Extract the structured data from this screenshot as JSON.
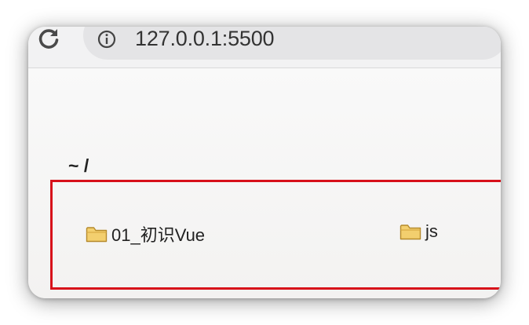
{
  "browser": {
    "url": "127.0.0.1:5500",
    "reload_icon": "reload-icon",
    "site_info_icon": "info-icon"
  },
  "page": {
    "heading": "~ /",
    "entries": [
      {
        "name": "01_初识Vue",
        "icon": "folder-icon"
      },
      {
        "name": "js",
        "icon": "folder-icon"
      }
    ]
  },
  "colors": {
    "highlight_border": "#d7101a",
    "folder_fill": "#f3cf6e",
    "folder_stroke": "#b58a2b"
  }
}
